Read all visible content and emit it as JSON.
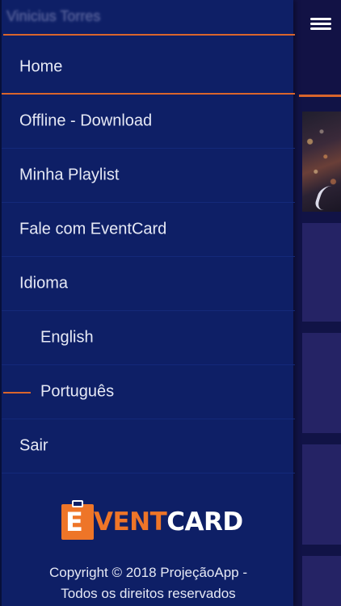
{
  "drawer": {
    "user_name": "Vinicius Torres",
    "items": [
      {
        "label": "Home"
      },
      {
        "label": "Offline - Download"
      },
      {
        "label": "Minha Playlist"
      },
      {
        "label": "Fale com EventCard"
      },
      {
        "label": "Idioma"
      },
      {
        "label": "English"
      },
      {
        "label": "Português"
      },
      {
        "label": "Sair"
      }
    ],
    "logo": {
      "e": "E",
      "vent": "VENT",
      "card": "CARD"
    },
    "copyright_line1": "Copyright © 2018 ProjeçãoApp -",
    "copyright_line2": "Todos os direitos reservados"
  },
  "header": {
    "menu_icon": "hamburger-icon"
  },
  "colors": {
    "accent": "#d9652c",
    "drawer_bg": "#0e1f66",
    "page_bg": "#111346",
    "logo_orange": "#ee7528"
  }
}
